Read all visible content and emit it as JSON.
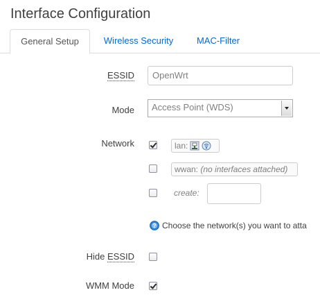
{
  "page": {
    "title": "Interface Configuration"
  },
  "tabs": [
    {
      "label": "General Setup",
      "active": true
    },
    {
      "label": "Wireless Security",
      "active": false
    },
    {
      "label": "MAC-Filter",
      "active": false
    }
  ],
  "fields": {
    "essid": {
      "label": "ESSID",
      "value": "OpenWrt"
    },
    "mode": {
      "label": "Mode",
      "selected": "Access Point (WDS)"
    },
    "network": {
      "label": "Network",
      "options": [
        {
          "name": "lan:",
          "checked": true,
          "icons": [
            "ethernet-icon",
            "wireless-icon"
          ]
        },
        {
          "name": "wwan:",
          "note": "(no interfaces attached)",
          "checked": false
        },
        {
          "name": "create:",
          "checked": false,
          "value": ""
        }
      ],
      "hint": "Choose the network(s) you want to atta"
    },
    "hide_essid": {
      "label_prefix": "Hide ",
      "label_abbr": "ESSID",
      "checked": false
    },
    "wmm_mode": {
      "label": "WMM Mode",
      "checked": true
    }
  },
  "colors": {
    "link": "#0069d6",
    "text": "#404040",
    "muted": "#808080",
    "border": "#dddddd",
    "help_icon": "#2a7fd4"
  }
}
